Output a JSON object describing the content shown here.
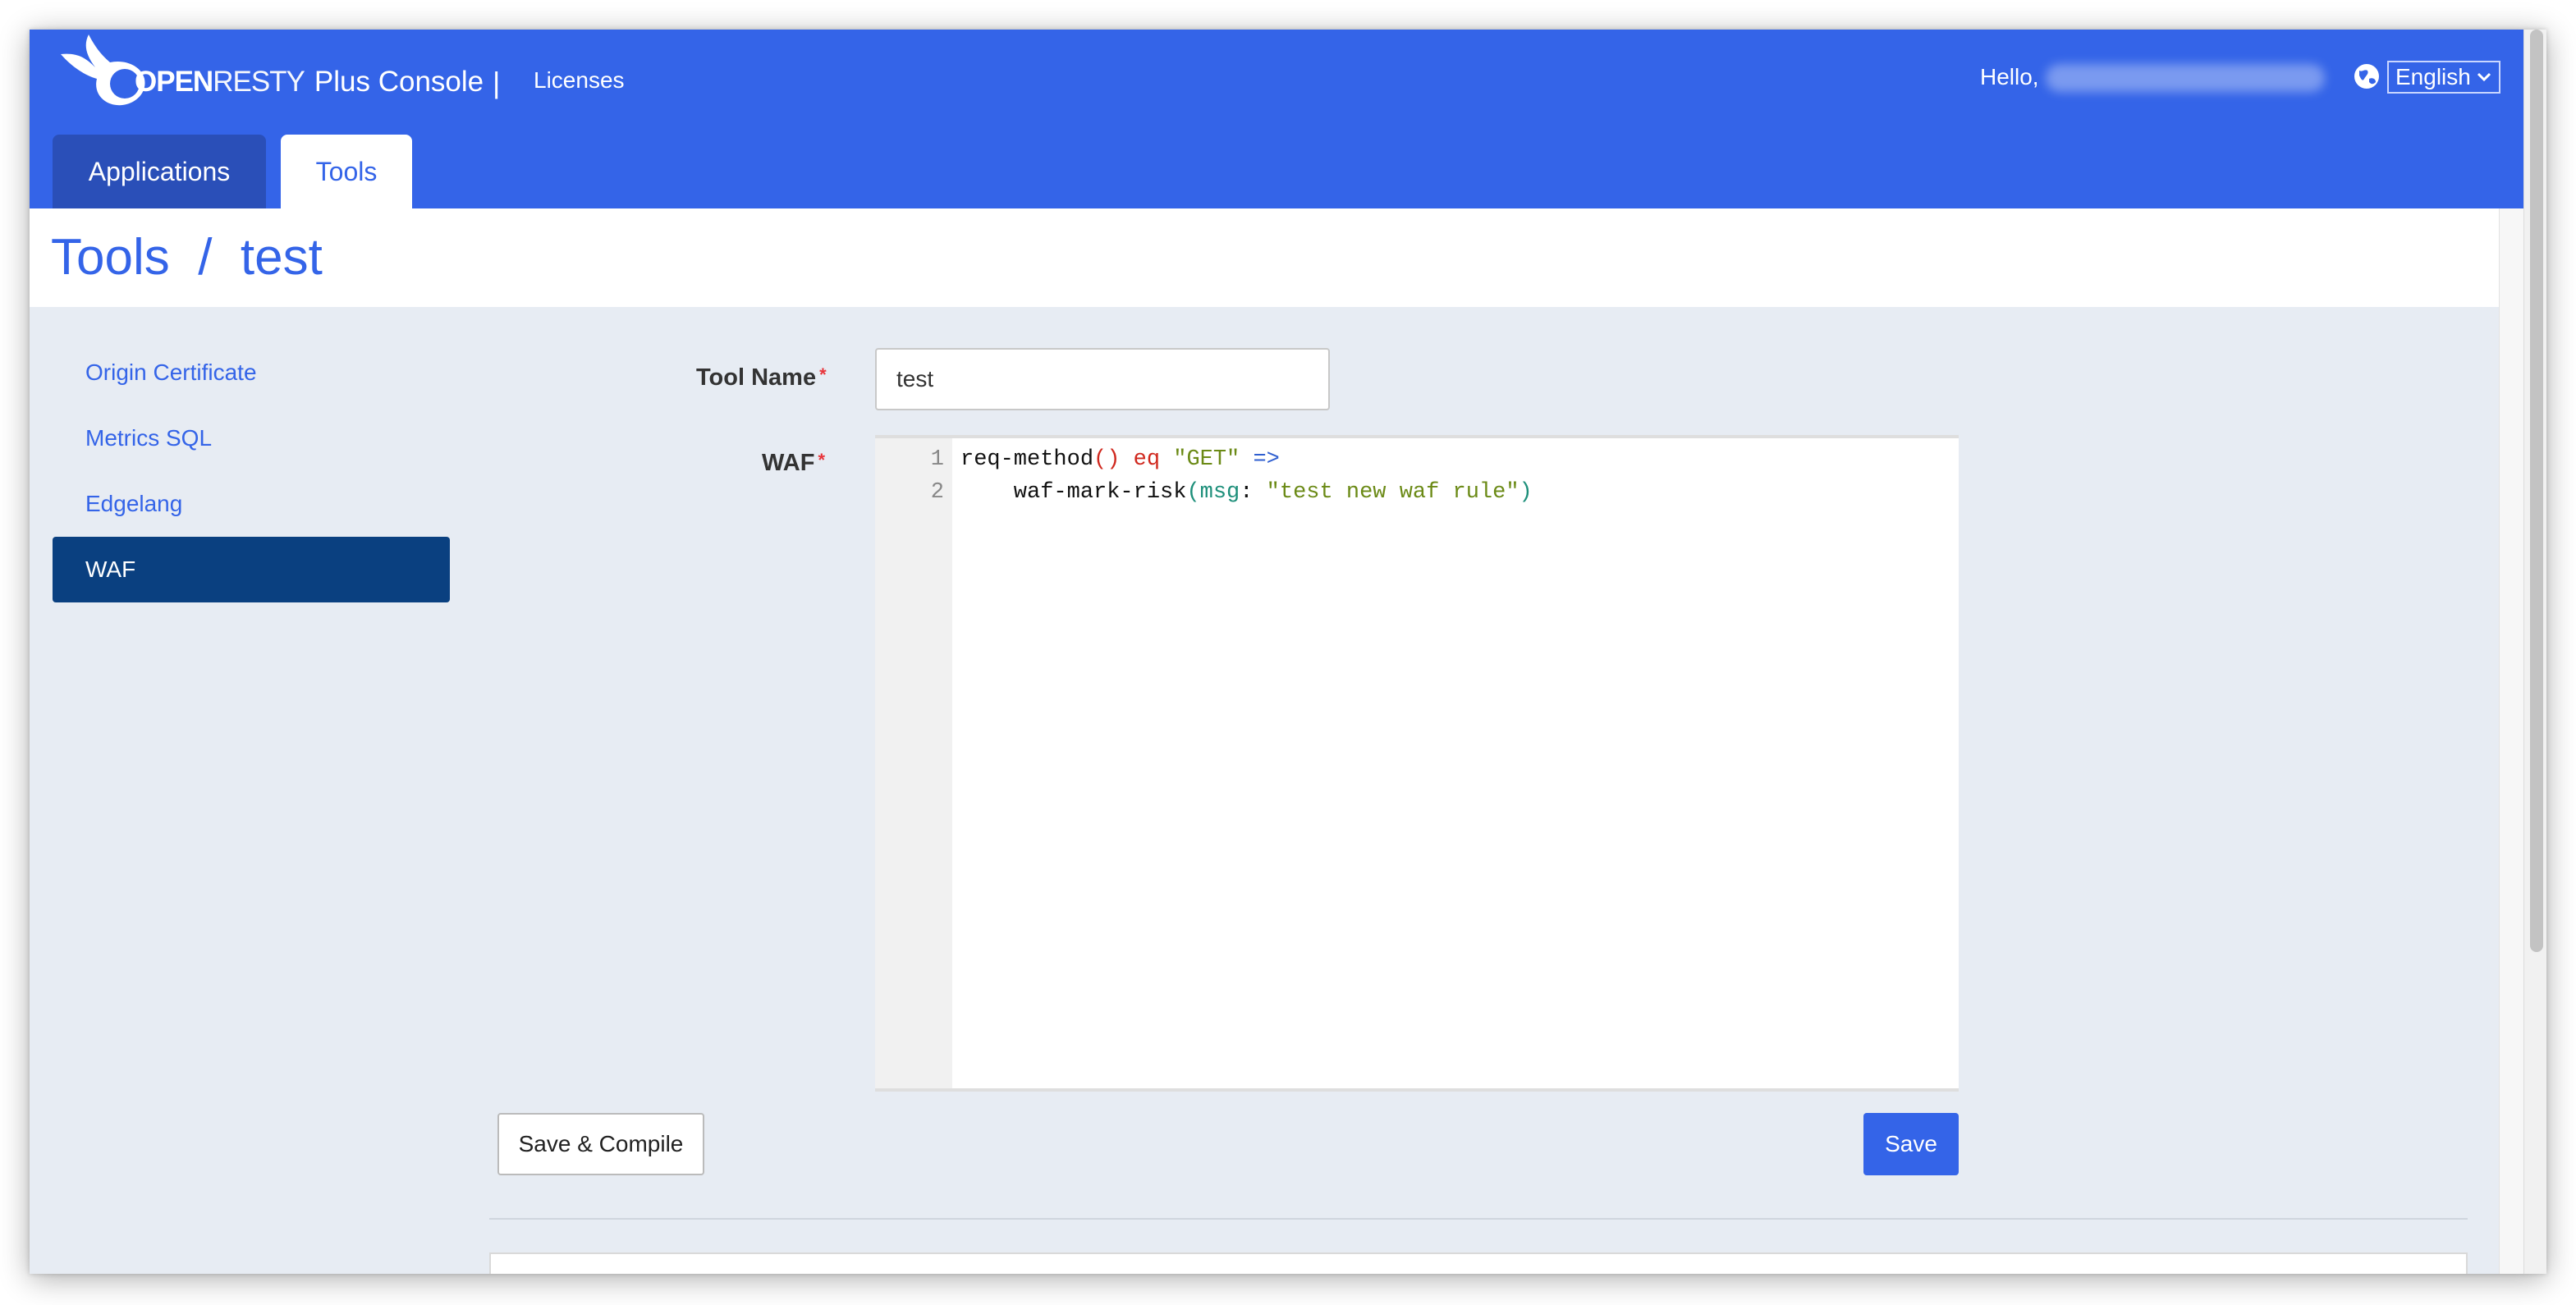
{
  "header": {
    "brand_open": "OPEN",
    "brand_resty": "RESTY",
    "brand_console": "Plus Console",
    "separator": "|",
    "licenses_link": "Licenses",
    "hello_text": "Hello,",
    "language": "English",
    "accent_color": "#3464e8"
  },
  "tabs": [
    {
      "label": "Applications",
      "active": false
    },
    {
      "label": "Tools",
      "active": true
    }
  ],
  "page": {
    "title": "Tools  /  test"
  },
  "sidebar": {
    "items": [
      {
        "label": "Origin Certificate",
        "active": false
      },
      {
        "label": "Metrics SQL",
        "active": false
      },
      {
        "label": "Edgelang",
        "active": false
      },
      {
        "label": "WAF",
        "active": true
      }
    ]
  },
  "form": {
    "tool_name_label": "Tool Name",
    "tool_name_value": "test",
    "waf_label": "WAF",
    "required_mark": "*",
    "code_lines": [
      {
        "number": "1",
        "text": "req-method() eq \"GET\" =>"
      },
      {
        "number": "2",
        "text": "    waf-mark-risk(msg: \"test new waf rule\")"
      }
    ]
  },
  "buttons": {
    "save_compile": "Save & Compile",
    "save": "Save"
  }
}
